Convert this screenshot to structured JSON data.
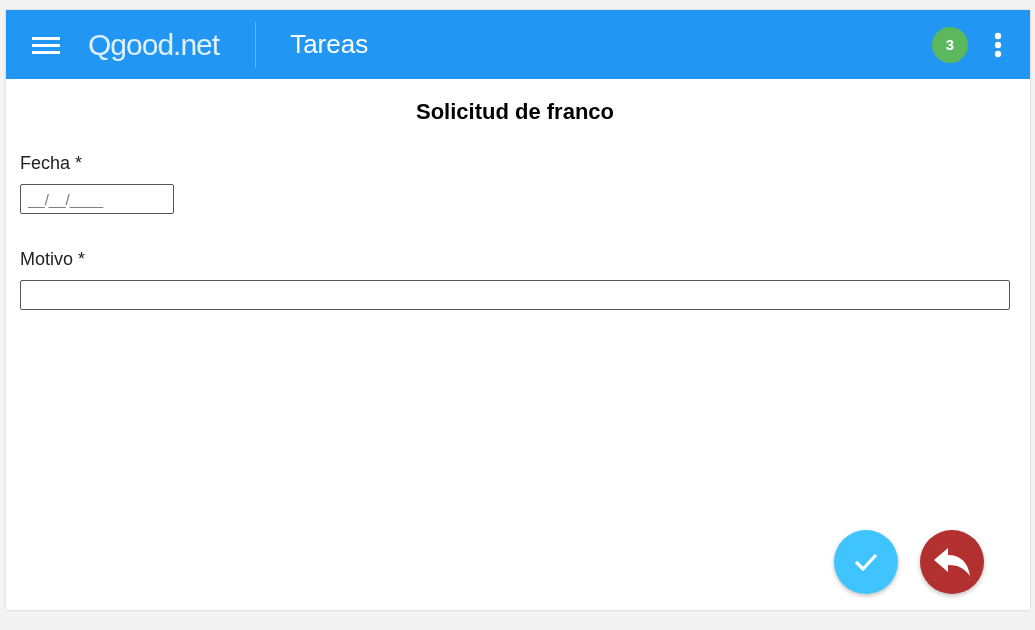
{
  "app_bar": {
    "brand": "Qgood.net",
    "title": "Tareas",
    "badge": "3"
  },
  "form": {
    "title": "Solicitud de franco",
    "fields": [
      {
        "label": "Fecha *",
        "placeholder": "__/__/____",
        "kind": "date"
      },
      {
        "label": "Motivo *",
        "kind": "text"
      }
    ]
  },
  "actions": [
    {
      "kind": "confirm"
    },
    {
      "kind": "back"
    }
  ]
}
